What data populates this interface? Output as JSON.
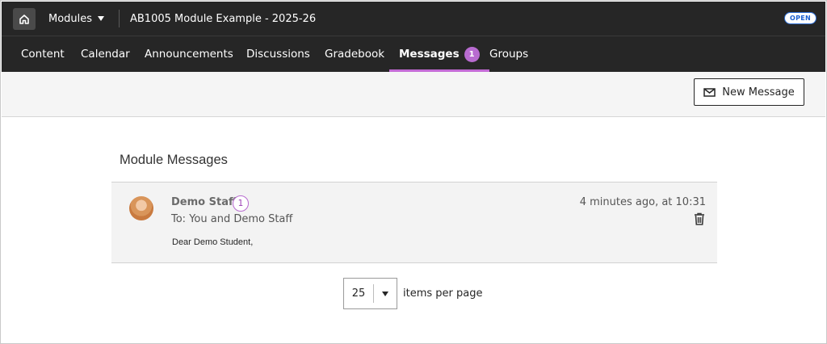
{
  "header": {
    "modules_label": "Modules",
    "course_title": "AB1005 Module Example - 2025-26",
    "status_badge": "OPEN"
  },
  "nav": {
    "tabs": [
      {
        "label": "Content"
      },
      {
        "label": "Calendar"
      },
      {
        "label": "Announcements"
      },
      {
        "label": "Discussions"
      },
      {
        "label": "Gradebook"
      },
      {
        "label": "Messages",
        "active": true,
        "count": "1"
      },
      {
        "label": "Groups"
      }
    ]
  },
  "toolbar": {
    "new_message_label": "New Message"
  },
  "section": {
    "title": "Module Messages"
  },
  "messages": [
    {
      "sender": "Demo Staff",
      "unread_count": "1",
      "recipients": "To: You and Demo Staff",
      "timestamp": "4 minutes ago, at 10:31",
      "preview": "Dear Demo Student,"
    }
  ],
  "pagination": {
    "per_page_value": "25",
    "per_page_label": "items per page"
  },
  "colors": {
    "accent": "#b86bd0",
    "header_bg": "#262626",
    "badge_blue": "#2f6fd6"
  },
  "icons": {
    "home": "home-icon",
    "new_message": "envelope-icon",
    "delete": "trash-icon"
  }
}
